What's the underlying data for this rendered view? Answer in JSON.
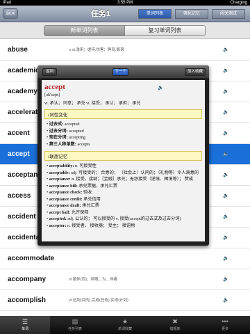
{
  "statusbar": {
    "carrier": "iPad",
    "time": "3:55 PM",
    "battery": "Charging"
  },
  "navbar": {
    "back": "返回",
    "title": "任务1",
    "tabs": [
      {
        "label": "单词列表",
        "active": true
      },
      {
        "label": "强化记忆",
        "active": false
      },
      {
        "label": "闯关测试",
        "active": false
      }
    ]
  },
  "segment": {
    "left": "新单词列表",
    "right": "复习单词列表"
  },
  "words": [
    {
      "word": "abuse",
      "def": "n.vt.滥用；虐待,伤害；辱骂,毁谤"
    },
    {
      "word": "academic",
      "def": ""
    },
    {
      "word": "academy",
      "def": ""
    },
    {
      "word": "accelerate",
      "def": ""
    },
    {
      "word": "accent",
      "def": ""
    },
    {
      "word": "accept",
      "def": "",
      "selected": true
    },
    {
      "word": "acceptance",
      "def": ""
    },
    {
      "word": "access",
      "def": ""
    },
    {
      "word": "accident",
      "def": ""
    },
    {
      "word": "accidental",
      "def": ""
    },
    {
      "word": "accommodate",
      "def": ""
    },
    {
      "word": "accompany",
      "def": "vt.陪伴(同)；伴随；为…伴奏"
    },
    {
      "word": "accomplish",
      "def": "vt.达到(目的),完成(任务),实现(计划)"
    },
    {
      "word": "accord",
      "def": ""
    }
  ],
  "popup": {
    "prev": "返回",
    "next": "下一个",
    "fav": "加入收藏",
    "headword": "accept",
    "phonetic": "[ək'sept]",
    "meaning": "vi. 承认； 同意； 承兑 vt. 接受； 承认； 承担； 承兑",
    "section1": "↓词性变化",
    "forms": [
      {
        "k": "过去式:",
        "v": " accepted"
      },
      {
        "k": "过去分词:",
        "v": " accepted"
      },
      {
        "k": "现在分词:",
        "v": " accepting"
      },
      {
        "k": "第三人称单数:",
        "v": " accepts"
      }
    ],
    "section2": "↓联想记忆",
    "assoc": [
      {
        "k": "acceptability:",
        "v": " n. 可接受性"
      },
      {
        "k": "acceptable:",
        "v": " adj. 可接受的； 合意的； （社会上）认同的；（礼物等）令人满意的"
      },
      {
        "k": "acceptance:",
        "v": " n. 接受，接纳；［金融］承兑；无怨接受（逆境、困境等）； 赞成"
      },
      {
        "k": "acceptance bill:",
        "v": " 承兑票据，承兑汇票"
      },
      {
        "k": "acceptance check:",
        "v": " 验收"
      },
      {
        "k": "acceptance credit:",
        "v": " 承兑信用"
      },
      {
        "k": "acceptance draft:",
        "v": " 承兑汇票"
      },
      {
        "k": "accept bail:",
        "v": " 允许保释"
      },
      {
        "k": "accepted:",
        "v": " adj. 公认的； 可以接受的 v. 接受(accept的过去式及过去分词)"
      },
      {
        "k": "acceptor:",
        "v": " n. 接受者， 接收器； 受主； 接语物"
      }
    ]
  },
  "tabbar": [
    {
      "label": "单词",
      "icon": "list-icon",
      "active": true
    },
    {
      "label": "任务列表",
      "icon": "clipboard-icon",
      "active": false
    },
    {
      "label": "单词收藏",
      "icon": "star-icon",
      "active": false
    },
    {
      "label": "错题库",
      "icon": "x-circle-icon",
      "active": false
    },
    {
      "label": "更多",
      "icon": "more-icon",
      "active": false
    }
  ]
}
